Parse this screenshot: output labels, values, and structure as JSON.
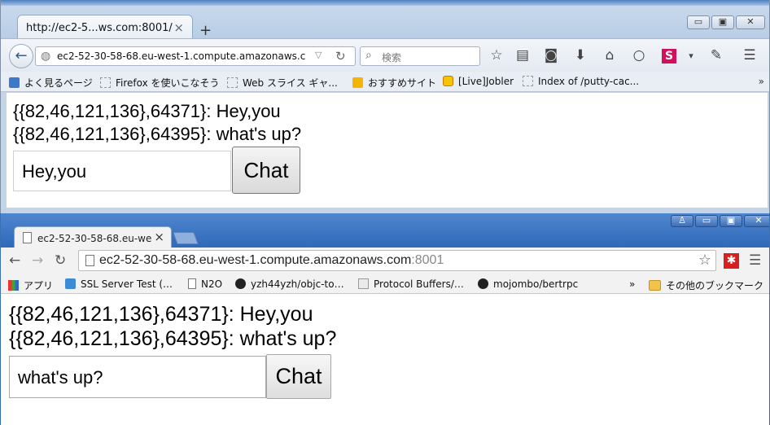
{
  "firefox": {
    "tab_title": "http://ec2-5...ws.com:8001/",
    "url": "ec2-52-30-58-68.eu-west-1.compute.amazonaws.c",
    "search_placeholder": "検索",
    "bookmarks": [
      {
        "label": "よく見るページ",
        "icon": "blue"
      },
      {
        "label": "Firefox を使いこなそう",
        "icon": "dash"
      },
      {
        "label": "Web スライス ギャ...",
        "icon": "dash"
      },
      {
        "label": "おすすめサイト",
        "icon": "bing"
      },
      {
        "label": "[Live]Jobler",
        "icon": "jobler"
      },
      {
        "label": "Index of /putty-cac...",
        "icon": "dash"
      }
    ],
    "bookmarks_overflow": "»",
    "messages": [
      "{{82,46,121,136},64371}: Hey,you",
      "{{82,46,121,136},64395}: what's up?"
    ],
    "input_value": "Hey,you",
    "chat_button": "Chat"
  },
  "chrome": {
    "tab_title": "ec2-52-30-58-68.eu-we",
    "url_host": "ec2-52-30-58-68.eu-west-1.compute.amazonaws.com",
    "url_port": ":8001",
    "bookmarks": [
      {
        "label": "アプリ",
        "icon": "apps"
      },
      {
        "label": "SSL Server Test (…",
        "icon": "lock"
      },
      {
        "label": "N2O",
        "icon": "page"
      },
      {
        "label": "yzh44yzh/objc-to…",
        "icon": "gh"
      },
      {
        "label": "Protocol Buffers/…",
        "icon": "info"
      },
      {
        "label": "mojombo/bertrpc",
        "icon": "gh"
      }
    ],
    "bookmarks_overflow": "»",
    "other_bookmarks": "その他のブックマーク",
    "messages": [
      "{{82,46,121,136},64371}: Hey,you",
      "{{82,46,121,136},64395}: what's up?"
    ],
    "input_value": "what's up?",
    "chat_button": "Chat"
  }
}
